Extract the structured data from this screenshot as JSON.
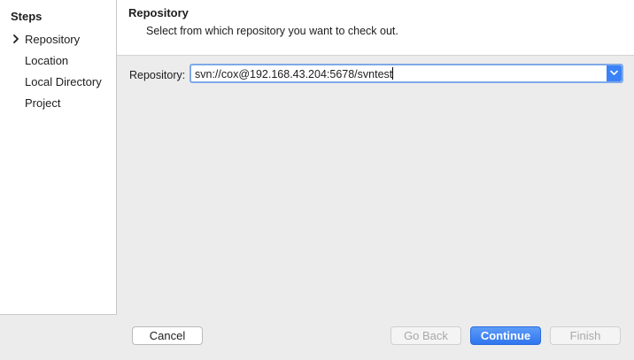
{
  "sidebar": {
    "title": "Steps",
    "items": [
      {
        "label": "Repository"
      },
      {
        "label": "Location"
      },
      {
        "label": "Local Directory"
      },
      {
        "label": "Project"
      }
    ]
  },
  "header": {
    "title": "Repository",
    "subtitle": "Select from which repository you want to check out."
  },
  "form": {
    "repository_label": "Repository:",
    "repository_value": "svn://cox@192.168.43.204:5678/svntest"
  },
  "buttons": {
    "cancel": "Cancel",
    "go_back": "Go Back",
    "continue": "Continue",
    "finish": "Finish"
  },
  "colors": {
    "accent": "#3b82f7",
    "focus_ring": "#7fa9e8"
  },
  "icons": {
    "current_step": "chevron-right-icon",
    "dropdown": "chevron-down-icon"
  }
}
